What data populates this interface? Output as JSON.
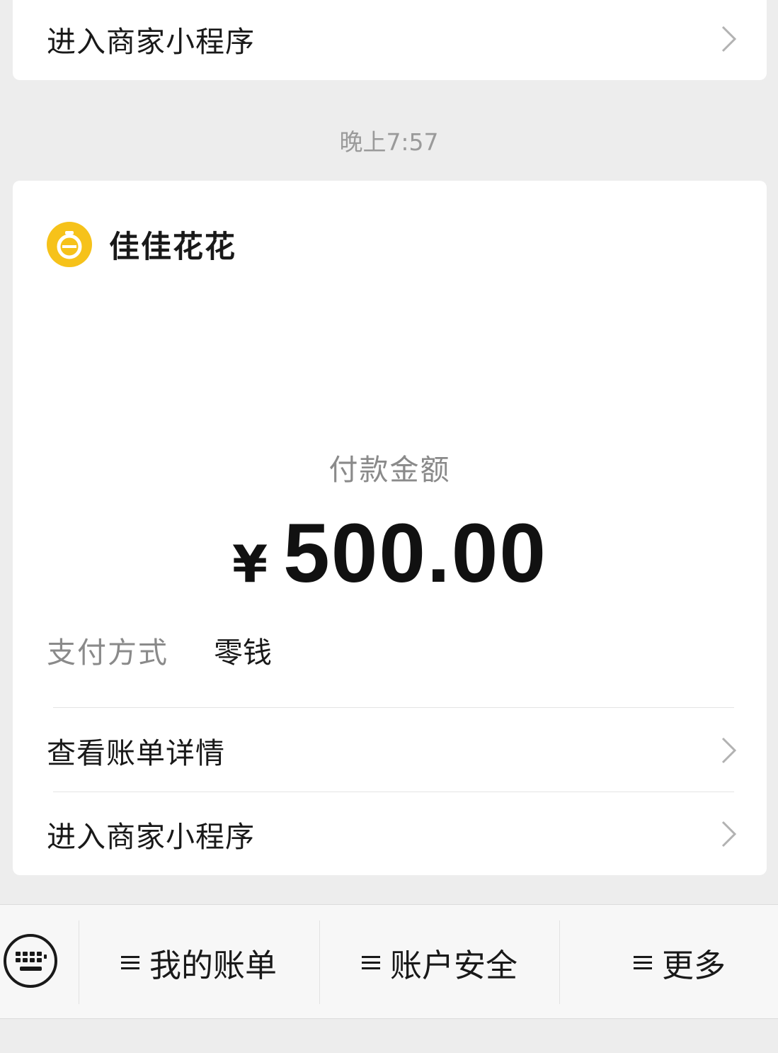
{
  "top_card": {
    "row_label": "进入商家小程序"
  },
  "timestamp": "晚上7:57",
  "payment_card": {
    "merchant_name": "佳佳花花",
    "amount_label": "付款金额",
    "currency_symbol": "¥",
    "amount": "500.00",
    "pay_method_label": "支付方式",
    "pay_method_value": "零钱",
    "rows": [
      {
        "label": "查看账单详情"
      },
      {
        "label": "进入商家小程序"
      }
    ]
  },
  "bottom_menu": {
    "keyboard_icon": "keyboard-icon",
    "items": [
      {
        "label": "我的账单"
      },
      {
        "label": "账户安全"
      },
      {
        "label": "更多"
      }
    ]
  },
  "colors": {
    "background": "#ededed",
    "card": "#ffffff",
    "logo": "#f6c21a",
    "muted_text": "#8a8a8a"
  }
}
